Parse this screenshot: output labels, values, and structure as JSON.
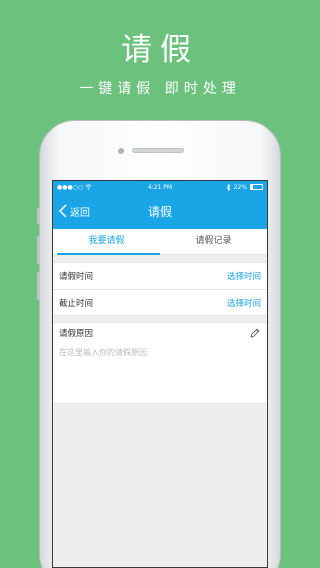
{
  "promo": {
    "title": "请假",
    "subtitle": "一键请假 即时处理"
  },
  "colors": {
    "background": "#6cc27c",
    "accent": "#1aa5e6"
  },
  "status_bar": {
    "signal": "●●●○○",
    "wifi_icon": "wifi-icon",
    "time": "4:21 PM",
    "bluetooth_icon": "bluetooth-icon",
    "battery": "22%",
    "battery_level": 0.22
  },
  "nav": {
    "back_label": "返回",
    "title": "请假"
  },
  "tabs": [
    {
      "label": "我要请假",
      "active": true
    },
    {
      "label": "请假记录",
      "active": false
    }
  ],
  "form": {
    "leave_time_label": "请假时间",
    "leave_time_action": "选择时间",
    "end_time_label": "截止时间",
    "end_time_action": "选择时间"
  },
  "reason": {
    "label": "请假原因",
    "edit_icon": "pencil-icon",
    "placeholder": "在这里输入你的请假原因",
    "value": ""
  }
}
